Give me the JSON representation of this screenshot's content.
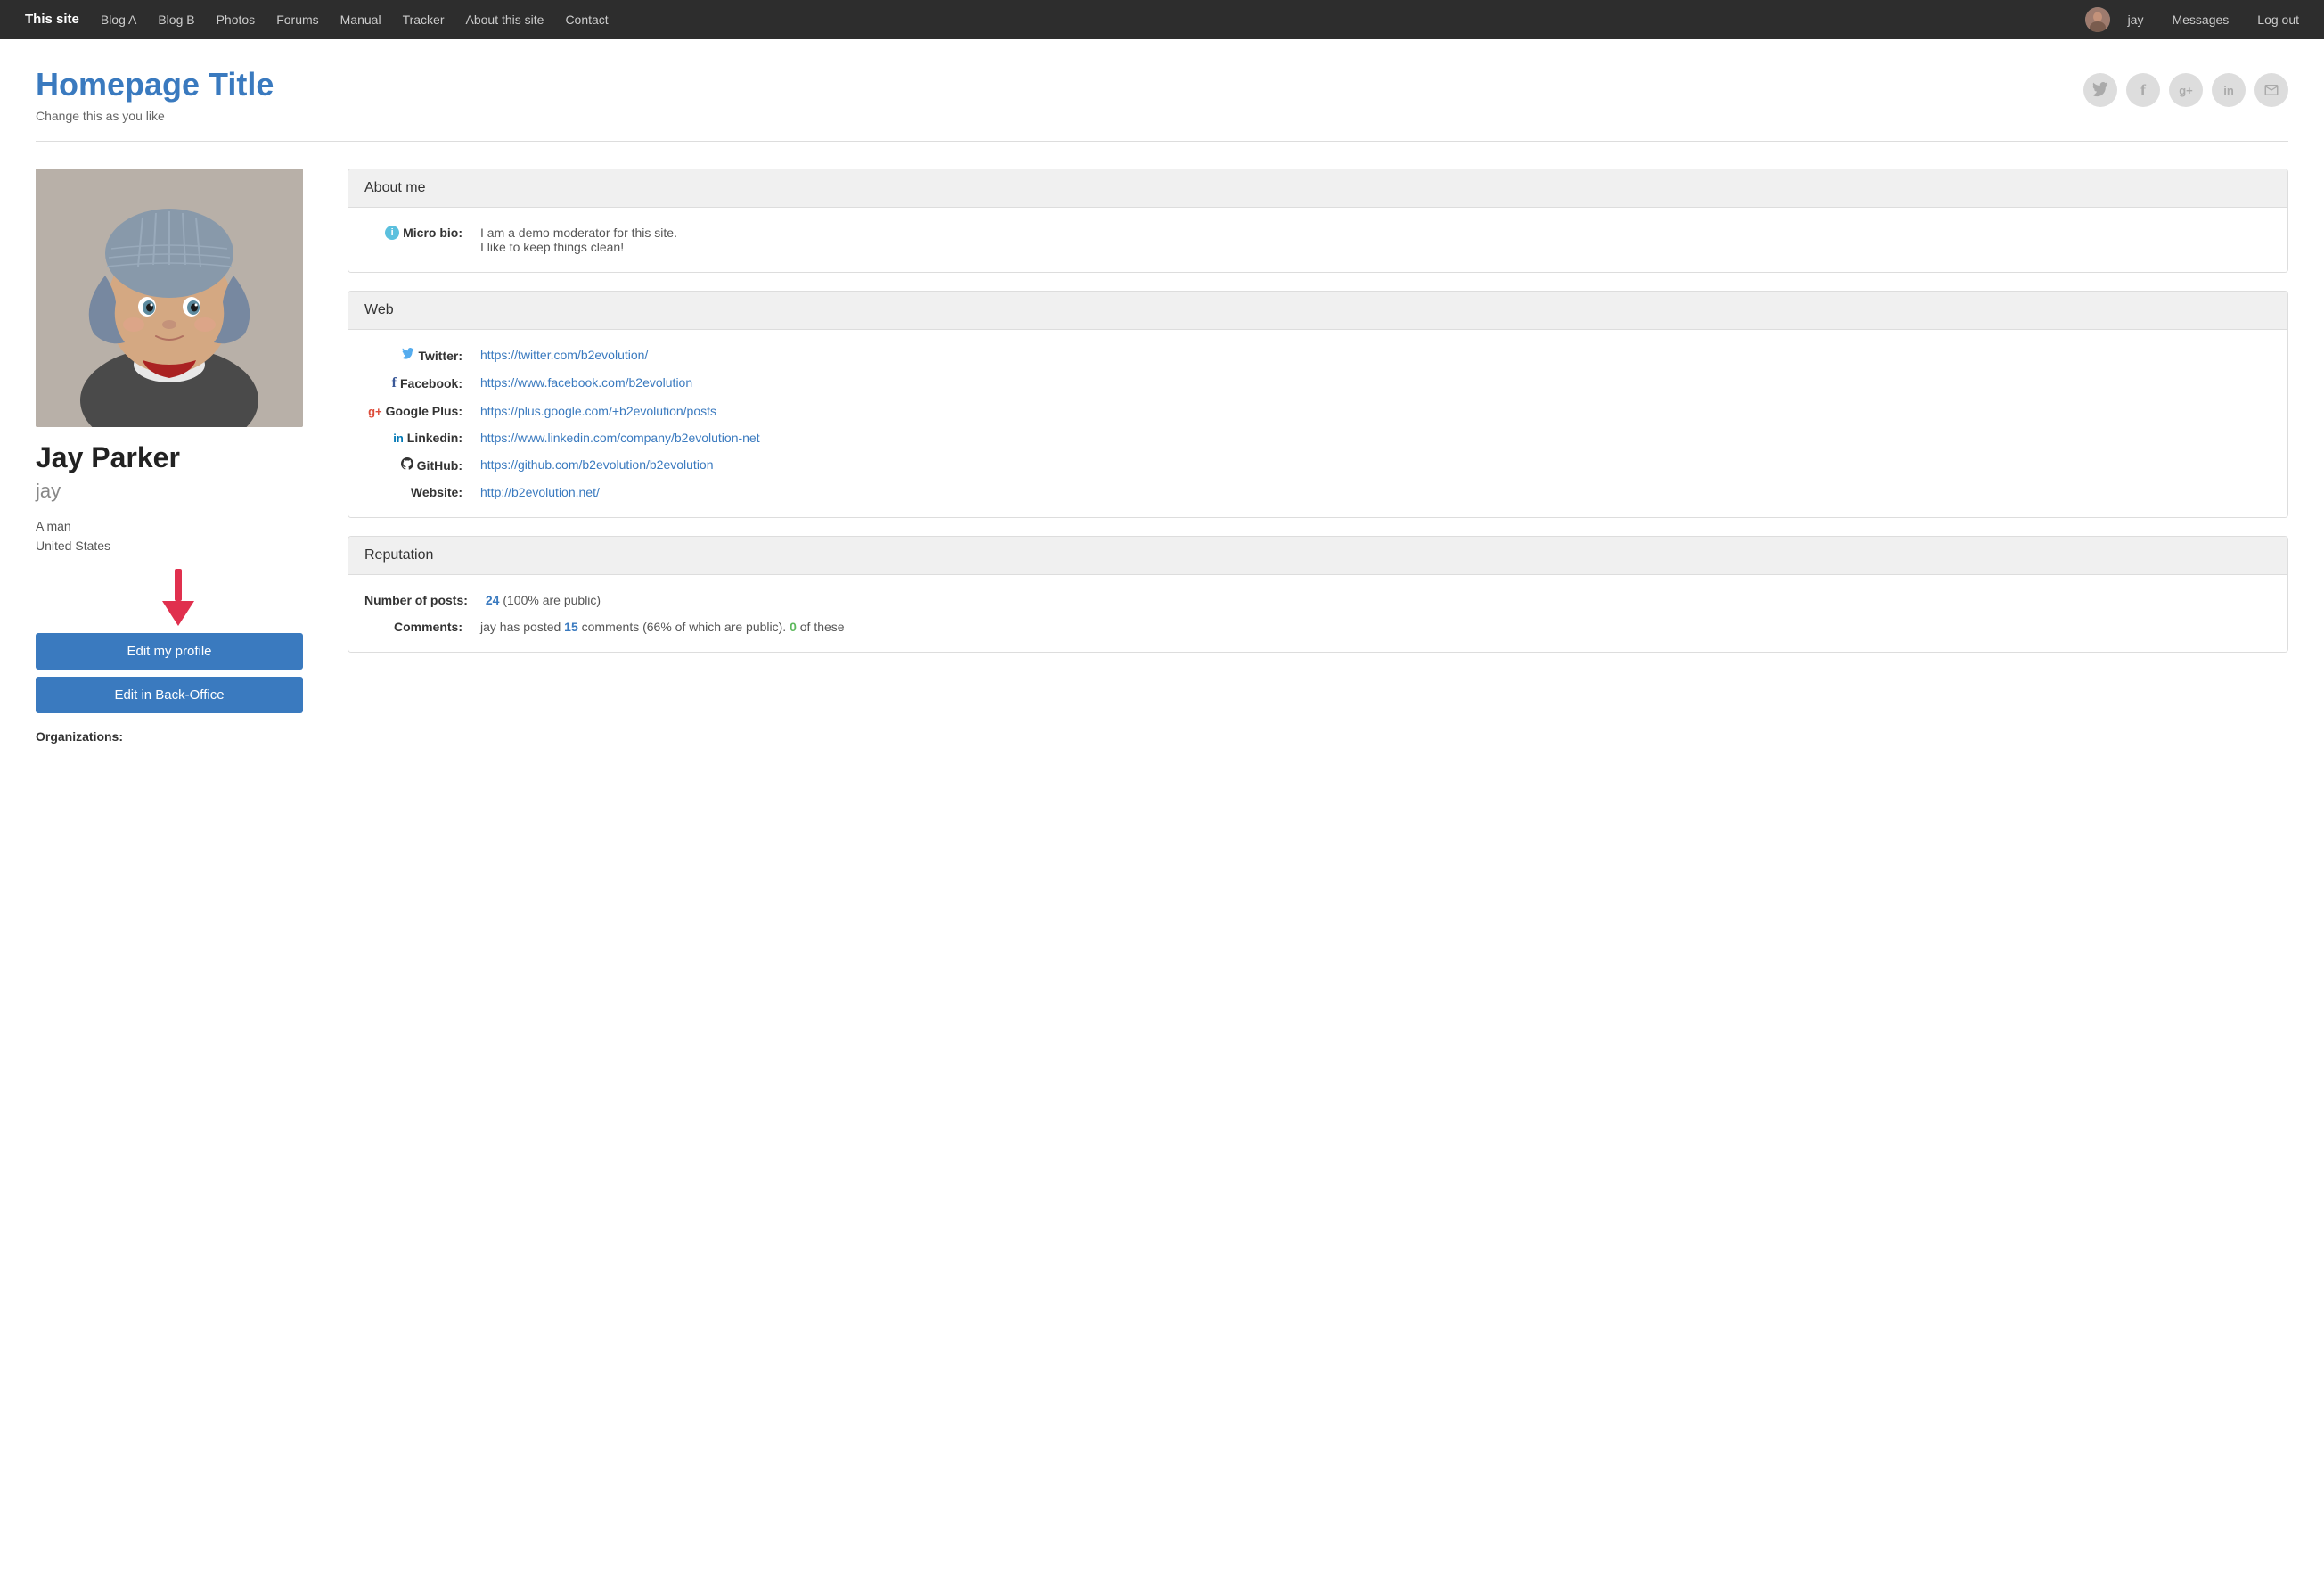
{
  "navbar": {
    "site_title": "This site",
    "links": [
      {
        "label": "Blog A",
        "href": "#"
      },
      {
        "label": "Blog B",
        "href": "#"
      },
      {
        "label": "Photos",
        "href": "#"
      },
      {
        "label": "Forums",
        "href": "#"
      },
      {
        "label": "Manual",
        "href": "#"
      },
      {
        "label": "Tracker",
        "href": "#"
      },
      {
        "label": "About this site",
        "href": "#"
      },
      {
        "label": "Contact",
        "href": "#"
      }
    ],
    "user_name": "jay",
    "messages_label": "Messages",
    "logout_label": "Log out"
  },
  "header": {
    "title": "Homepage Title",
    "tagline": "Change this as you like"
  },
  "social_buttons": [
    {
      "name": "twitter",
      "symbol": "🐦"
    },
    {
      "name": "facebook",
      "symbol": "f"
    },
    {
      "name": "google-plus",
      "symbol": "g+"
    },
    {
      "name": "linkedin",
      "symbol": "in"
    },
    {
      "name": "github",
      "symbol": "✉"
    }
  ],
  "profile": {
    "full_name": "Jay Parker",
    "username": "jay",
    "gender": "A man",
    "location": "United States",
    "edit_profile_label": "Edit my profile",
    "edit_backoffice_label": "Edit in Back-Office",
    "organizations_label": "Organizations:"
  },
  "about_me": {
    "section_title": "About me",
    "micro_bio_label": "Micro bio:",
    "micro_bio_line1": "I am a demo moderator for this site.",
    "micro_bio_line2": "I like to keep things clean!"
  },
  "web": {
    "section_title": "Web",
    "twitter_label": "Twitter:",
    "twitter_url": "https://twitter.com/b2evolution/",
    "facebook_label": "Facebook:",
    "facebook_url": "https://www.facebook.com/b2evolution",
    "googleplus_label": "Google Plus:",
    "googleplus_url": "https://plus.google.com/+b2evolution/posts",
    "linkedin_label": "Linkedin:",
    "linkedin_url": "https://www.linkedin.com/company/b2evolution-net",
    "github_label": "GitHub:",
    "github_url": "https://github.com/b2evolution/b2evolution",
    "website_label": "Website:",
    "website_url": "http://b2evolution.net/"
  },
  "reputation": {
    "section_title": "Reputation",
    "posts_label": "Number of posts:",
    "posts_count": "24",
    "posts_detail": "(100% are public)",
    "comments_label": "Comments:",
    "comments_text": "jay has posted ",
    "comments_count": "15",
    "comments_detail": " comments (66% of which are public). ",
    "comments_zero": "0",
    "comments_suffix": " of these"
  }
}
